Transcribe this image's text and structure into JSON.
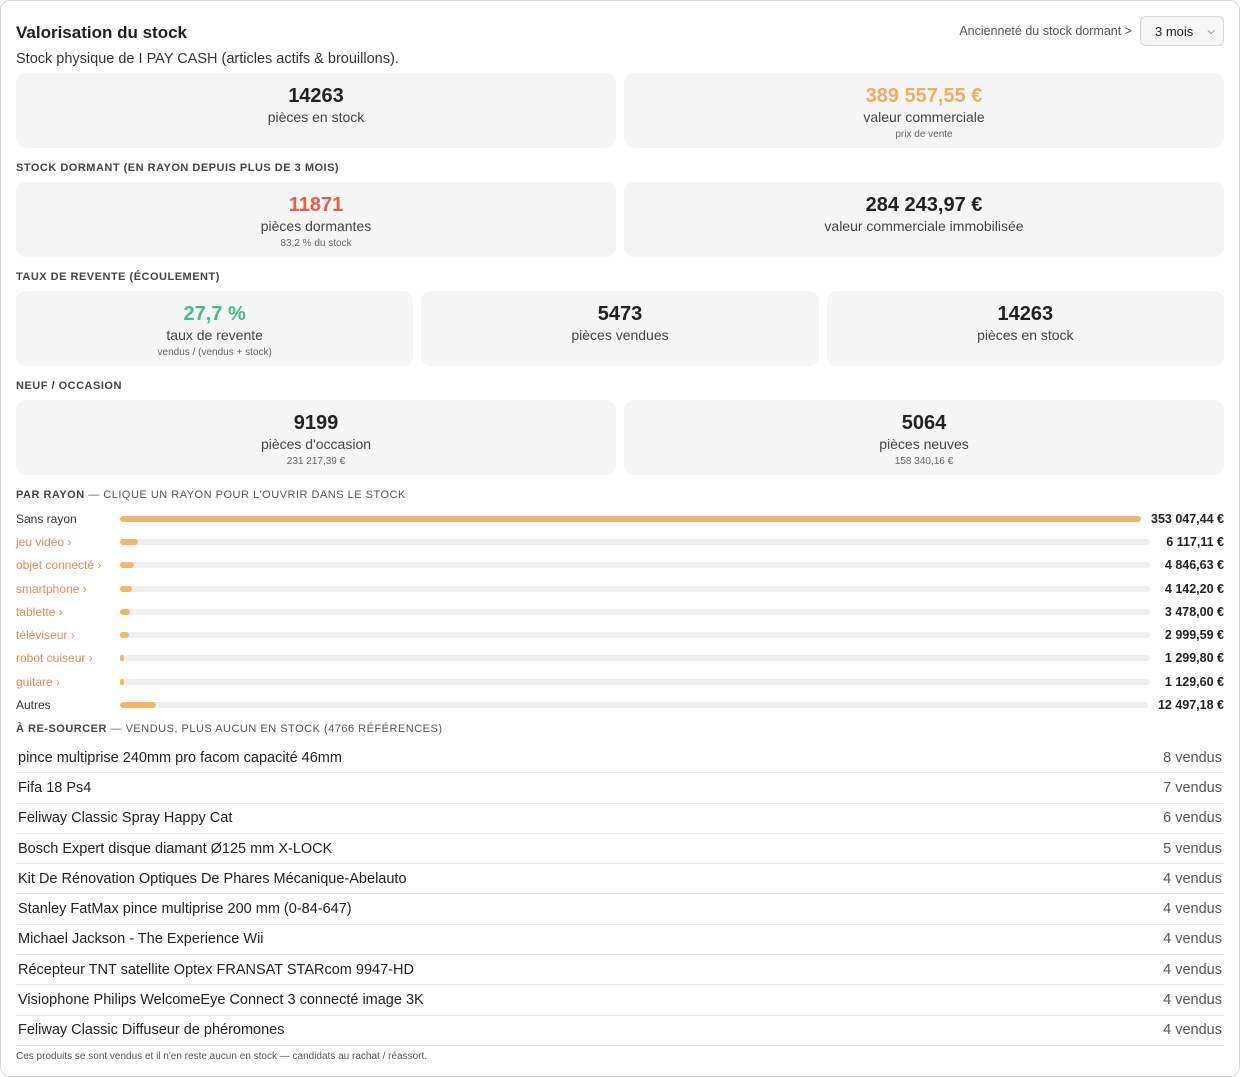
{
  "header": {
    "title": "Valorisation du stock",
    "dormant_label": "Ancienneté du stock dormant >",
    "dormant_select_value": "3 mois",
    "subtitle": "Stock physique de I PAY CASH (articles actifs & brouillons)."
  },
  "summary": [
    {
      "value": "14263",
      "label": "pièces en stock",
      "sub": ""
    },
    {
      "value": "389 557,55 €",
      "label": "valeur commerciale",
      "sub": "prix de vente"
    }
  ],
  "dormant": {
    "heading": "STOCK DORMANT (EN RAYON DEPUIS PLUS DE 3 MOIS)",
    "cards": [
      {
        "value": "11871",
        "label": "pièces dormantes",
        "sub": "83,2 % du stock"
      },
      {
        "value": "284 243,97 €",
        "label": "valeur commerciale immobilisée",
        "sub": ""
      }
    ]
  },
  "turnover": {
    "heading": "TAUX DE REVENTE (ÉCOULEMENT)",
    "cards": [
      {
        "value": "27,7 %",
        "label": "taux de revente",
        "sub": "vendus / (vendus + stock)"
      },
      {
        "value": "5473",
        "label": "pièces vendues",
        "sub": ""
      },
      {
        "value": "14263",
        "label": "pièces en stock",
        "sub": ""
      }
    ]
  },
  "condition": {
    "heading": "NEUF / OCCASION",
    "cards": [
      {
        "value": "9199",
        "label": "pièces d'occasion",
        "sub": "231 217,39 €"
      },
      {
        "value": "5064",
        "label": "pièces neuves",
        "sub": "158 340,16 €"
      }
    ]
  },
  "by_department": {
    "heading": "PAR RAYON",
    "heading_muted": "— CLIQUE UN RAYON POUR L'OUVRIR DANS LE STOCK",
    "rows": [
      {
        "name": "Sans rayon",
        "value": "353 047,44 €",
        "fraction": 1.0,
        "link": false
      },
      {
        "name": "jeu vidéo ›",
        "value": "6 117,11 €",
        "fraction": 0.0173,
        "link": true
      },
      {
        "name": "objet connecté ›",
        "value": "4 846,63 €",
        "fraction": 0.0137,
        "link": true
      },
      {
        "name": "smartphone ›",
        "value": "4 142,20 €",
        "fraction": 0.0117,
        "link": true
      },
      {
        "name": "tablette ›",
        "value": "3 478,00 €",
        "fraction": 0.0099,
        "link": true
      },
      {
        "name": "téléviseur ›",
        "value": "2 999,59 €",
        "fraction": 0.0085,
        "link": true
      },
      {
        "name": "robot cuiseur ›",
        "value": "1 299,80 €",
        "fraction": 0.0037,
        "link": true
      },
      {
        "name": "guitare ›",
        "value": "1 129,60 €",
        "fraction": 0.0032,
        "link": true
      },
      {
        "name": "Autres",
        "value": "12 497,18 €",
        "fraction": 0.0354,
        "link": false
      }
    ]
  },
  "resource": {
    "heading": "À RE-SOURCER",
    "heading_muted": "— VENDUS, PLUS AUCUN EN STOCK (4766 RÉFÉRENCES)",
    "items": [
      {
        "name": "pince multiprise 240mm pro facom capacité 46mm",
        "count": "8 vendus"
      },
      {
        "name": "Fifa 18 Ps4",
        "count": "7 vendus"
      },
      {
        "name": "Feliway Classic Spray Happy Cat",
        "count": "6 vendus"
      },
      {
        "name": "Bosch Expert disque diamant Ø125 mm X-LOCK",
        "count": "5 vendus"
      },
      {
        "name": "Kit De Rénovation Optiques De Phares Mécanique-Abelauto",
        "count": "4 vendus"
      },
      {
        "name": "Stanley FatMax pince multiprise 200 mm (0-84-647)",
        "count": "4 vendus"
      },
      {
        "name": "Michael Jackson - The Experience Wii",
        "count": "4 vendus"
      },
      {
        "name": "Récepteur TNT satellite Optex FRANSAT STARcom 9947-HD",
        "count": "4 vendus"
      },
      {
        "name": "Visiophone Philips WelcomeEye Connect 3 connecté image 3K",
        "count": "4 vendus"
      },
      {
        "name": "Feliway Classic Diffuseur de phéromones",
        "count": "4 vendus"
      }
    ],
    "footnote": "Ces produits se sont vendus et il n'en reste aucun en stock — candidats au rachat / réassort."
  },
  "colors": {
    "accent_orange": "#f0ad5b",
    "alert_red": "#ef5a4a",
    "success_green": "#3fbf7f",
    "bar_fill": "#f0b866",
    "link": "#e28a5a"
  }
}
